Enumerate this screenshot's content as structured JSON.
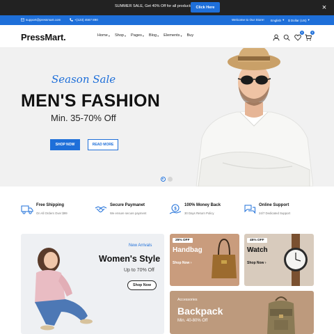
{
  "promo": {
    "text": "SUMMER SALE, Get 40% Off for all products.",
    "button": "Click Here",
    "close": "×"
  },
  "infobar": {
    "email": "support@pressmart.com",
    "phone": "+(123) 4567 890",
    "welcome": "Welcome to Our Store!",
    "language": "English",
    "currency": "$ Dollar (US)"
  },
  "header": {
    "logo": "PressMart.",
    "nav": [
      {
        "label": "Home",
        "has_dropdown": true
      },
      {
        "label": "Shop",
        "has_dropdown": true
      },
      {
        "label": "Pages",
        "has_dropdown": true
      },
      {
        "label": "Blog",
        "has_dropdown": true
      },
      {
        "label": "Elements",
        "has_dropdown": true
      },
      {
        "label": "Buy",
        "has_dropdown": false
      }
    ],
    "icons": [
      "user-icon",
      "search-icon",
      "heart-icon",
      "cart-icon"
    ],
    "wishlist_count": "0",
    "cart_count": "0"
  },
  "hero": {
    "subtitle": "Season Sale",
    "title": "MEN'S FASHION",
    "price": "Min. 35-70% Off",
    "shop_button": "SHOP NOW",
    "more_button": "READ MORE",
    "slides": 2,
    "active_slide": 1
  },
  "features": [
    {
      "icon": "truck-icon",
      "title": "Free Shipping",
      "sub": "On All Orders Over $99"
    },
    {
      "icon": "handshake-icon",
      "title": "Secure Paymanet",
      "sub": "We ensure secure payment"
    },
    {
      "icon": "money-back-icon",
      "title": "100% Money Back",
      "sub": "30 Days Return Policy"
    },
    {
      "icon": "chat-icon",
      "title": "Online Support",
      "sub": "24/7 Dedicated Support"
    }
  ],
  "banners": {
    "women": {
      "label": "New Arrivals",
      "title": "Women's Style",
      "off": "Up to 70% Off",
      "button": "Shop Now"
    },
    "handbag": {
      "tag": "25% OFF",
      "title": "Handbag",
      "link": "Shop Now ›"
    },
    "watch": {
      "tag": "45% OFF",
      "title": "Watch",
      "link": "Shop Now ›"
    },
    "backpack": {
      "label": "Accessories",
      "title": "Backpack",
      "off": "Min. 40-80% Off"
    }
  },
  "colors": {
    "accent": "#1e6fd9",
    "promo_bar": "#222222",
    "hero_bg": "#f1f1f1",
    "handbag_bg": "#c99c7d",
    "watch_bg": "#d8cbbd",
    "backpack_bg": "#bd9a7d"
  }
}
